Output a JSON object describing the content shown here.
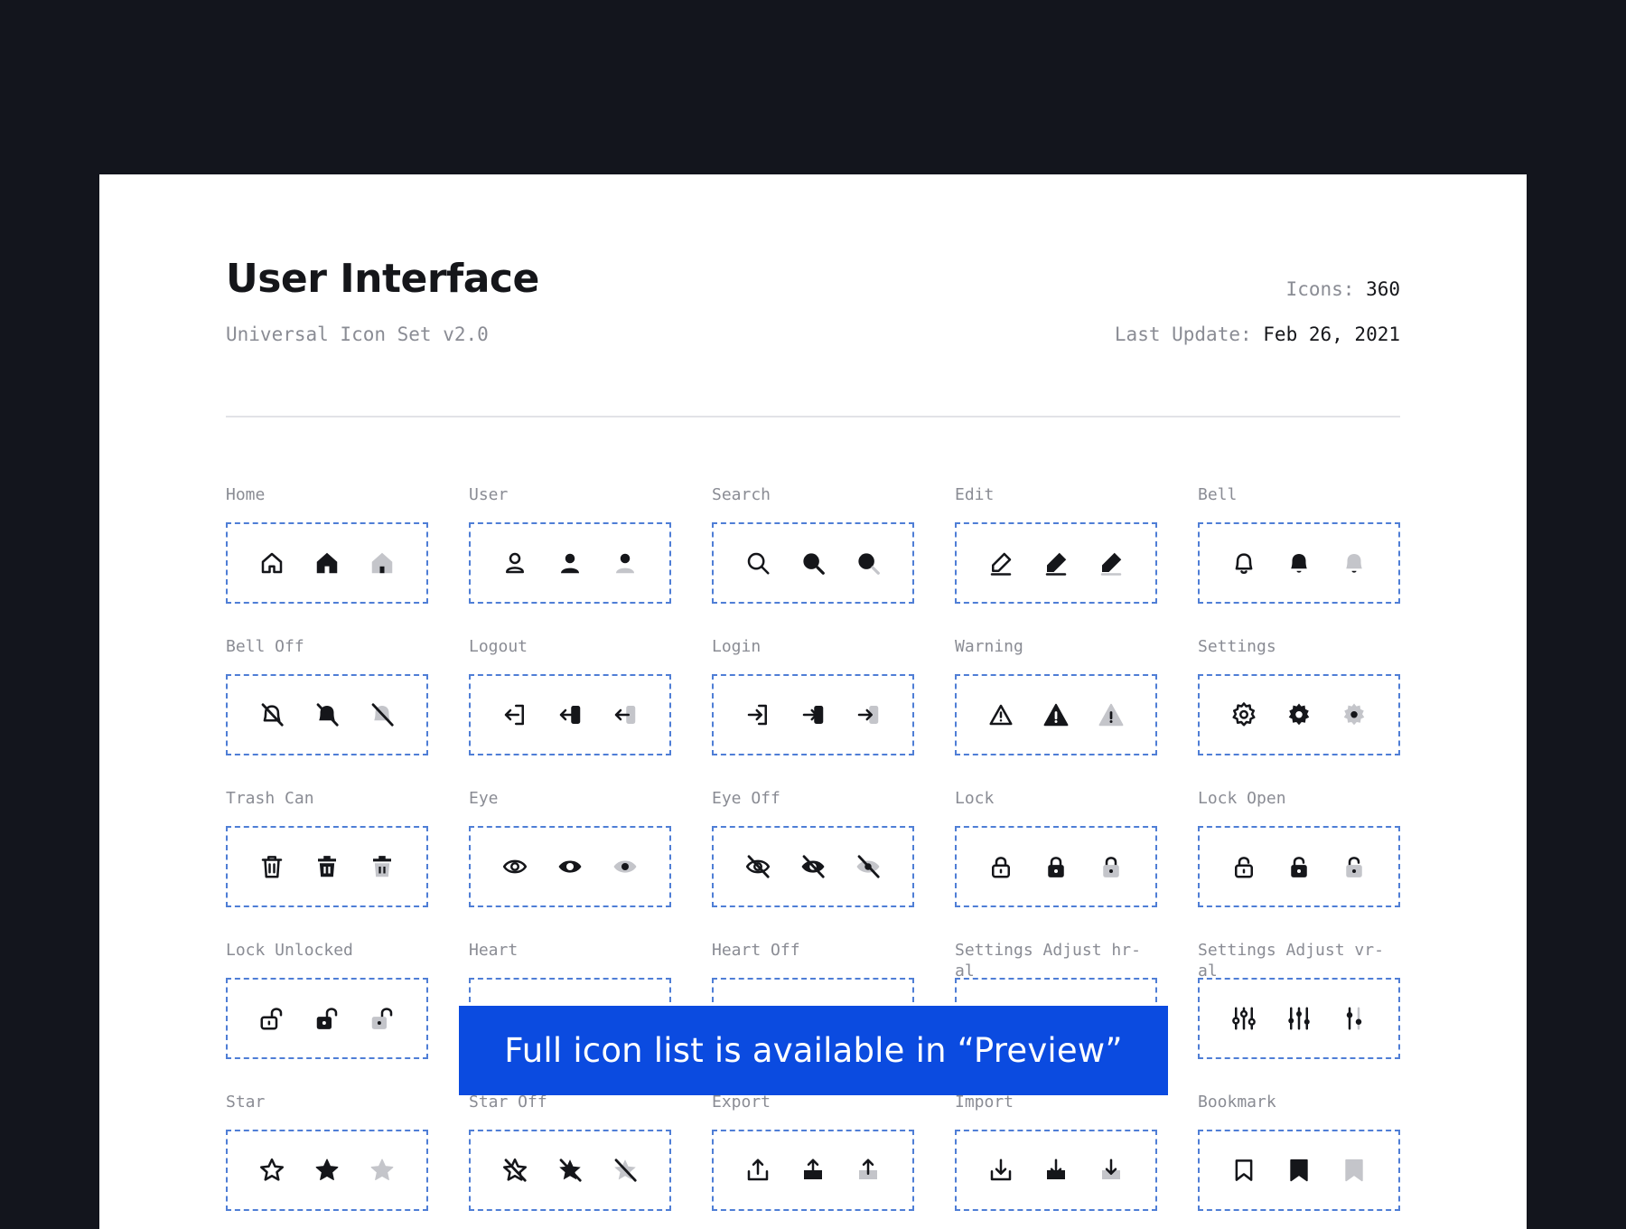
{
  "header": {
    "title": "User Interface",
    "subtitle": "Universal Icon Set v2.0",
    "icons_label": "Icons:",
    "icons_value": "360",
    "update_label": "Last Update:",
    "update_value": "Feb 26, 2021"
  },
  "banner": {
    "text": "Full icon list is available in “Preview”"
  },
  "colors": {
    "accent": "#4f7ed6",
    "banner": "#0b4be0",
    "outline": "#15161a",
    "duotone": "#c4c5ca",
    "background": "#13151d"
  },
  "icon_groups": [
    {
      "label": "Home",
      "icons": [
        "home-outline-icon",
        "home-solid-icon",
        "home-duotone-icon"
      ]
    },
    {
      "label": "User",
      "icons": [
        "user-outline-icon",
        "user-solid-icon",
        "user-duotone-icon"
      ]
    },
    {
      "label": "Search",
      "icons": [
        "search-outline-icon",
        "search-solid-icon",
        "search-duotone-icon"
      ]
    },
    {
      "label": "Edit",
      "icons": [
        "edit-outline-icon",
        "edit-solid-icon",
        "edit-duotone-icon"
      ]
    },
    {
      "label": "Bell",
      "icons": [
        "bell-outline-icon",
        "bell-solid-icon",
        "bell-duotone-icon"
      ]
    },
    {
      "label": "Bell Off",
      "icons": [
        "bell-off-outline-icon",
        "bell-off-solid-icon",
        "bell-off-duotone-icon"
      ]
    },
    {
      "label": "Logout",
      "icons": [
        "logout-outline-icon",
        "logout-solid-icon",
        "logout-duotone-icon"
      ]
    },
    {
      "label": "Login",
      "icons": [
        "login-outline-icon",
        "login-solid-icon",
        "login-duotone-icon"
      ]
    },
    {
      "label": "Warning",
      "icons": [
        "warning-outline-icon",
        "warning-solid-icon",
        "warning-duotone-icon"
      ]
    },
    {
      "label": "Settings",
      "icons": [
        "settings-outline-icon",
        "settings-solid-icon",
        "settings-duotone-icon"
      ]
    },
    {
      "label": "Trash Can",
      "icons": [
        "trash-outline-icon",
        "trash-solid-icon",
        "trash-duotone-icon"
      ]
    },
    {
      "label": "Eye",
      "icons": [
        "eye-outline-icon",
        "eye-solid-icon",
        "eye-duotone-icon"
      ]
    },
    {
      "label": "Eye Off",
      "icons": [
        "eye-off-outline-icon",
        "eye-off-solid-icon",
        "eye-off-duotone-icon"
      ]
    },
    {
      "label": "Lock",
      "icons": [
        "lock-outline-icon",
        "lock-solid-icon",
        "lock-duotone-icon"
      ]
    },
    {
      "label": "Lock Open",
      "icons": [
        "lock-open-outline-icon",
        "lock-open-solid-icon",
        "lock-open-duotone-icon"
      ]
    },
    {
      "label": "Lock Unlocked",
      "icons": [
        "lock-unlocked-outline-icon",
        "lock-unlocked-solid-icon",
        "lock-unlocked-duotone-icon"
      ]
    },
    {
      "label": "Heart",
      "icons": [
        "heart-outline-icon",
        "heart-solid-icon",
        "heart-duotone-icon"
      ]
    },
    {
      "label": "Heart Off",
      "icons": [
        "heart-off-outline-icon",
        "heart-off-solid-icon",
        "heart-off-duotone-icon"
      ]
    },
    {
      "label": "Settings Adjust hr-al",
      "icons": [
        "sliders-horizontal-outline-icon",
        "sliders-horizontal-solid-icon",
        "sliders-horizontal-duotone-icon"
      ]
    },
    {
      "label": "Settings Adjust vr-al",
      "icons": [
        "sliders-vertical-outline-icon",
        "sliders-vertical-solid-icon",
        "sliders-vertical-duotone-icon"
      ]
    },
    {
      "label": "Star",
      "icons": [
        "star-outline-icon",
        "star-solid-icon",
        "star-duotone-icon"
      ]
    },
    {
      "label": "Star Off",
      "icons": [
        "star-off-outline-icon",
        "star-off-solid-icon",
        "star-off-duotone-icon"
      ]
    },
    {
      "label": "Export",
      "icons": [
        "export-outline-icon",
        "export-solid-icon",
        "export-duotone-icon"
      ]
    },
    {
      "label": "Import",
      "icons": [
        "import-outline-icon",
        "import-solid-icon",
        "import-duotone-icon"
      ]
    },
    {
      "label": "Bookmark",
      "icons": [
        "bookmark-outline-icon",
        "bookmark-solid-icon",
        "bookmark-duotone-icon"
      ]
    }
  ]
}
